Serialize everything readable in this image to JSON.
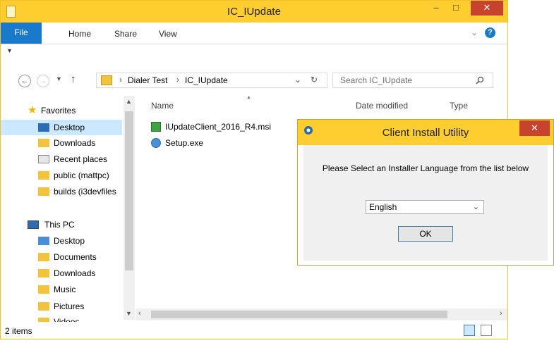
{
  "explorer": {
    "title": "IC_IUpdate",
    "window_buttons": {
      "minimize": "–",
      "maximize": "□",
      "close": "✕"
    },
    "ribbon": {
      "file": "File",
      "tabs": [
        "Home",
        "Share",
        "View"
      ],
      "expand": "⌄",
      "help": "?"
    },
    "qat_arrow": "▾",
    "address": {
      "segments": [
        "Dialer Test",
        "IC_IUpdate"
      ],
      "sep": "›",
      "dropdown": "⌄",
      "refresh": "↻"
    },
    "search": {
      "placeholder": "Search IC_IUpdate"
    },
    "nav": {
      "favorites_label": "Favorites",
      "favorites": [
        "Desktop",
        "Downloads",
        "Recent places",
        "public (mattpc)",
        "builds (i3devfiles"
      ],
      "thispc_label": "This PC",
      "thispc": [
        "Desktop",
        "Documents",
        "Downloads",
        "Music",
        "Pictures",
        "Videos"
      ]
    },
    "columns": {
      "name": "Name",
      "date": "Date modified",
      "type": "Type"
    },
    "files": [
      "IUpdateClient_2016_R4.msi",
      "Setup.exe"
    ],
    "status": "2 items"
  },
  "dialog": {
    "title": "Client Install Utility",
    "close": "✕",
    "message": "Please Select an Installer Language from the list below",
    "language": "English",
    "ok": "OK"
  }
}
